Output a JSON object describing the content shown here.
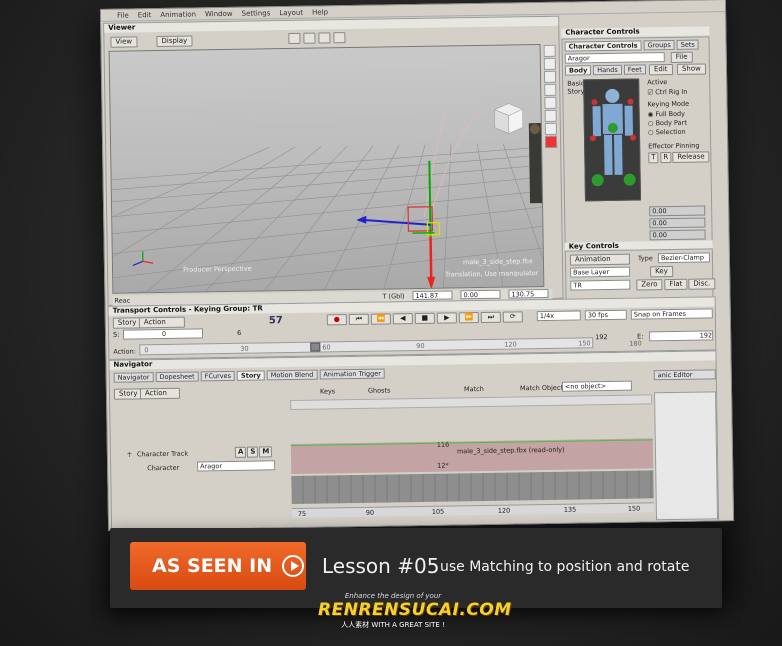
{
  "menu": [
    "File",
    "Edit",
    "Animation",
    "Window",
    "Settings",
    "Layout",
    "Help"
  ],
  "viewer": {
    "title": "Viewer",
    "view_btn": "View",
    "display_btn": "Display",
    "perspective_label": "Producer Perspective",
    "file_label": "male_3_side_step.fbx",
    "translation_label": "Translation, Use manipulator",
    "status": "Reac",
    "coord_mode": "T (Gbl)",
    "coord_x": "141.87",
    "coord_y": "0.00",
    "coord_z": "130.75"
  },
  "character_controls": {
    "title": "Character Controls",
    "tabs": [
      "Character Controls",
      "Groups",
      "Sets"
    ],
    "character": "Aragor",
    "file_btn": "File",
    "sub_tabs": [
      "Body",
      "Hands",
      "Feet"
    ],
    "edit_btn": "Edit",
    "show_btn": "Show",
    "basic_label": "Basic Story",
    "active_label": "Active",
    "ctrl_rig_label": "Ctrl Rig In",
    "keying_mode_label": "Keying Mode",
    "full_body": "Full Body",
    "body_part": "Body Part",
    "selection": "Selection",
    "effector_label": "Effector Pinning",
    "t_btn": "T",
    "r_btn": "R",
    "release_btn": "Release",
    "slider_values": [
      "0.00",
      "0.00",
      "0.00"
    ]
  },
  "key_controls": {
    "title": "Key Controls",
    "animation_label": "Animation",
    "type_label": "Type",
    "type_value": "Bezier-Clamp",
    "base_layer": "Base Layer",
    "key_btn": "Key",
    "tr_value": "TR",
    "zero_btn": "Zero",
    "flat_btn": "Flat",
    "disc_btn": "Disc."
  },
  "transport": {
    "title": "Transport Controls - Keying Group: TR",
    "story_btn": "Story",
    "action_btn": "Action",
    "s_label": "S:",
    "s_value": "0",
    "frame_value": "6",
    "counter": "57",
    "speed": "1/4x",
    "fps": "30 fps",
    "snap": "Snap on Frames",
    "end_value": "192",
    "e_label": "E:",
    "e_value": "192",
    "action_label": "Action:",
    "ruler_ticks": [
      "0",
      "30",
      "60",
      "90",
      "120",
      "150",
      "180"
    ]
  },
  "navigator": {
    "title": "Navigator",
    "tabs": [
      "Navigator",
      "Dopesheet",
      "FCurves",
      "Story",
      "Motion Blend",
      "Animation Trigger"
    ],
    "active_tab": "Story",
    "story_btn": "Story",
    "action_btn": "Action",
    "keys_label": "Keys",
    "ghosts_label": "Ghosts",
    "match_label": "Match",
    "match_object_label": "Match Object",
    "match_object_value": "<no object>",
    "character_track": "Character Track",
    "track_flags": [
      "A",
      "S",
      "M"
    ],
    "character_label": "Character",
    "character_value": "Aragor",
    "clip_label": "male_3_side_step.fbx (read-only)",
    "clip_start": "116",
    "clip_mark": "12*",
    "ruler_ticks": [
      "75",
      "90",
      "105",
      "120",
      "135",
      "150"
    ],
    "side_tab": "anic Editor"
  },
  "banner": {
    "as_seen_in": "AS SEEN IN",
    "lesson": "Lesson #05",
    "lesson_desc": "use Matching to position and rotate"
  },
  "watermark": {
    "line1": "Enhance the design of your",
    "line2": "RENRENSUCAI.COM",
    "line3": "人人素材  WITH A GREAT SITE !"
  }
}
